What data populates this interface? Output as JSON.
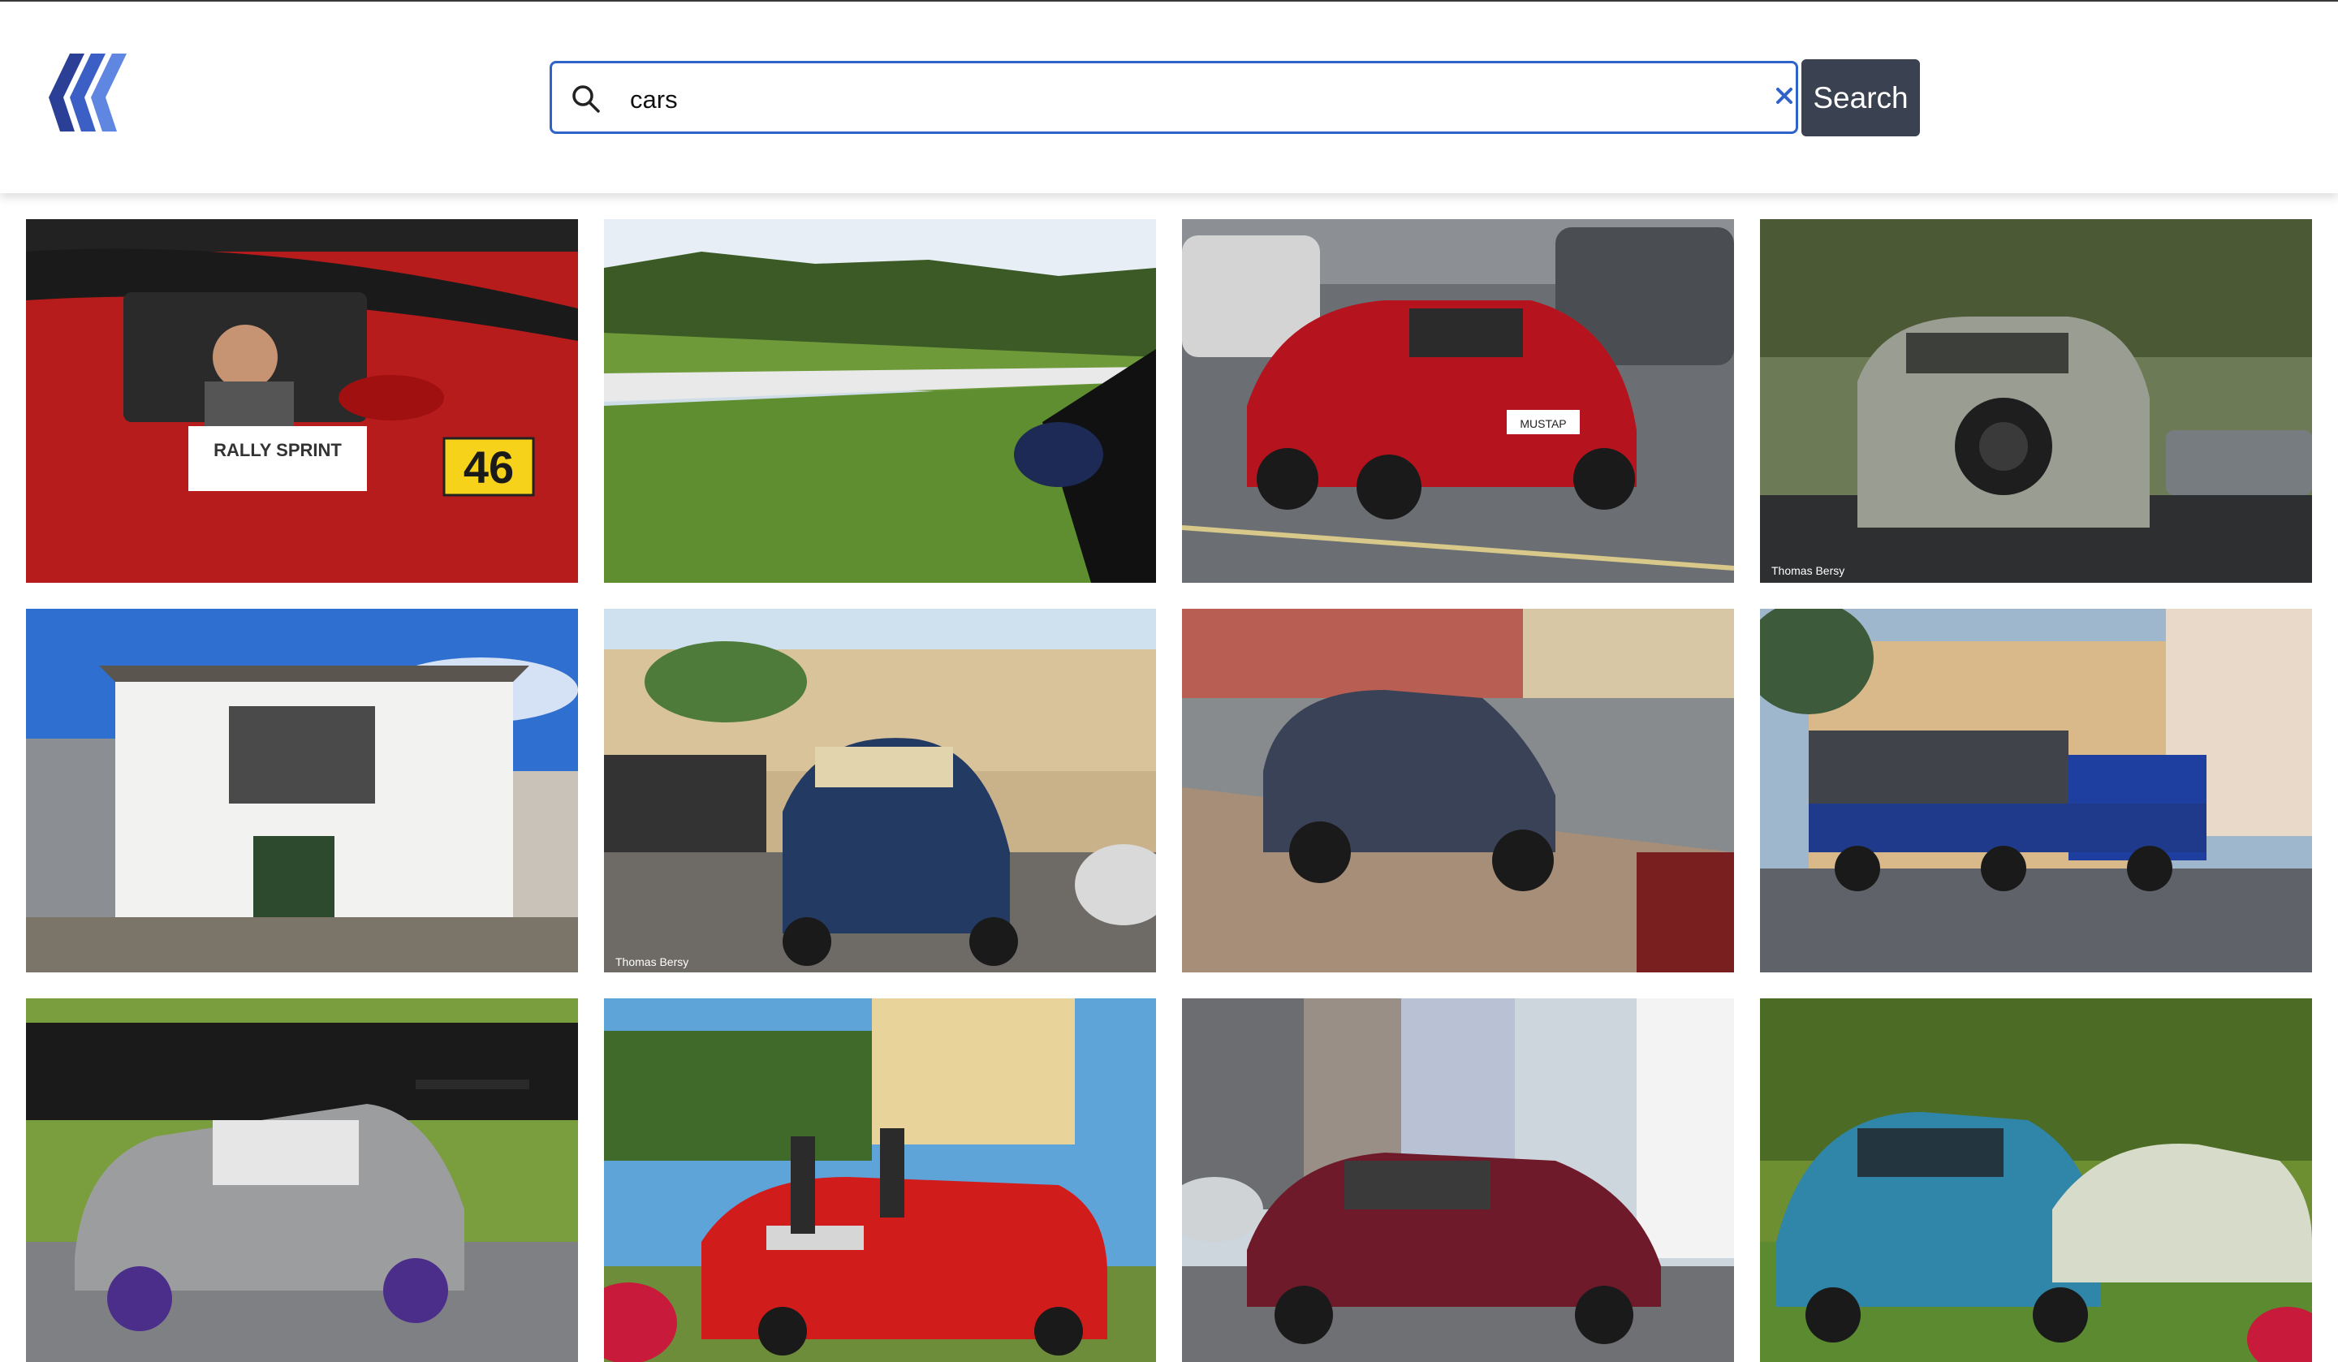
{
  "search": {
    "query": "cars",
    "button_label": "Search",
    "icon": "search-icon",
    "clear_icon": "close-icon"
  },
  "logo": {
    "icon": "brand-logo",
    "colors": [
      "#3b5fc4",
      "#2a3f95",
      "#5f86e0"
    ]
  },
  "results": [
    {
      "caption": "",
      "plate": "46",
      "sticker": "RALLY SPRINT"
    },
    {
      "caption": ""
    },
    {
      "caption": "",
      "plate": "MUSTAP"
    },
    {
      "caption": "Thomas Bersy"
    },
    {
      "caption": ""
    },
    {
      "caption": "Thomas Bersy"
    },
    {
      "caption": ""
    },
    {
      "caption": ""
    },
    {
      "caption": ""
    },
    {
      "caption": ""
    },
    {
      "caption": ""
    },
    {
      "caption": ""
    }
  ],
  "colors": {
    "accent": "#2f63c9",
    "button_bg": "#3a4150"
  }
}
